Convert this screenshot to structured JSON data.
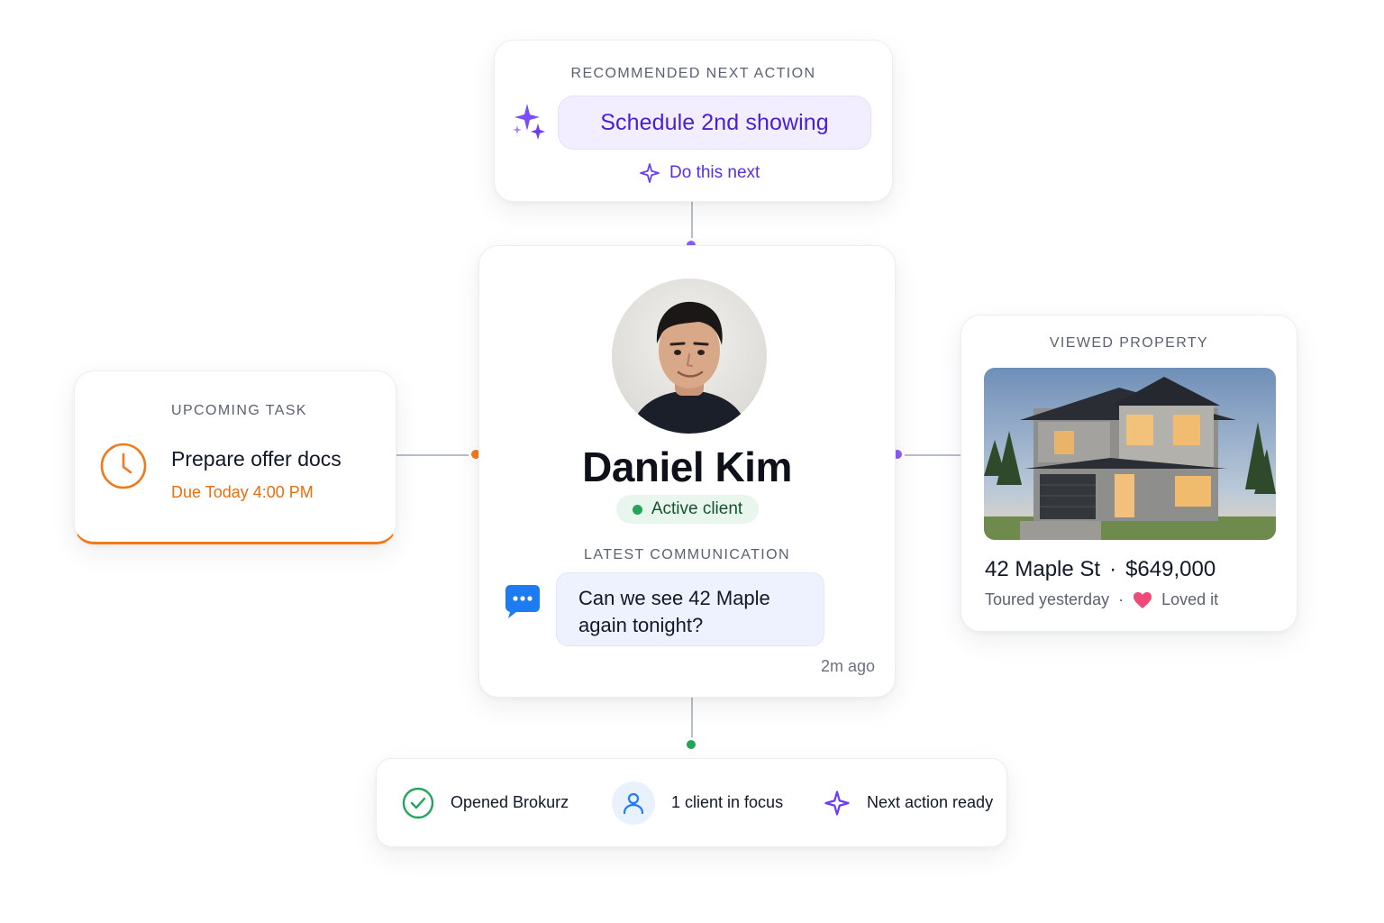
{
  "next_action": {
    "eyebrow": "RECOMMENDED NEXT ACTION",
    "action": "Schedule 2nd showing",
    "cta": "Do this next"
  },
  "client": {
    "name": "Daniel Kim",
    "status": "Active client",
    "comm_label": "LATEST COMMUNICATION",
    "message": "Can we see 42 Maple again tonight?",
    "message_time": "2m ago"
  },
  "task": {
    "eyebrow": "UPCOMING TASK",
    "title": "Prepare offer docs",
    "due": "Due Today 4:00 PM"
  },
  "property": {
    "eyebrow": "VIEWED PROPERTY",
    "address": "42 Maple St",
    "separator": "·",
    "price": "$649,000",
    "toured": "Toured yesterday",
    "reaction": "Loved it"
  },
  "status_bar": {
    "item1": "Opened Brokurz",
    "item2": "1 client in focus",
    "item3": "Next action ready"
  },
  "colors": {
    "accent_purple": "#7c4dff",
    "task_orange": "#f07a1a",
    "success_green": "#22a55b",
    "message_blue": "#1d7cf2"
  },
  "icons": [
    "sparkle-icon",
    "clock-icon",
    "chat-bubble-icon",
    "check-circle-icon",
    "user-icon",
    "heart-icon"
  ]
}
